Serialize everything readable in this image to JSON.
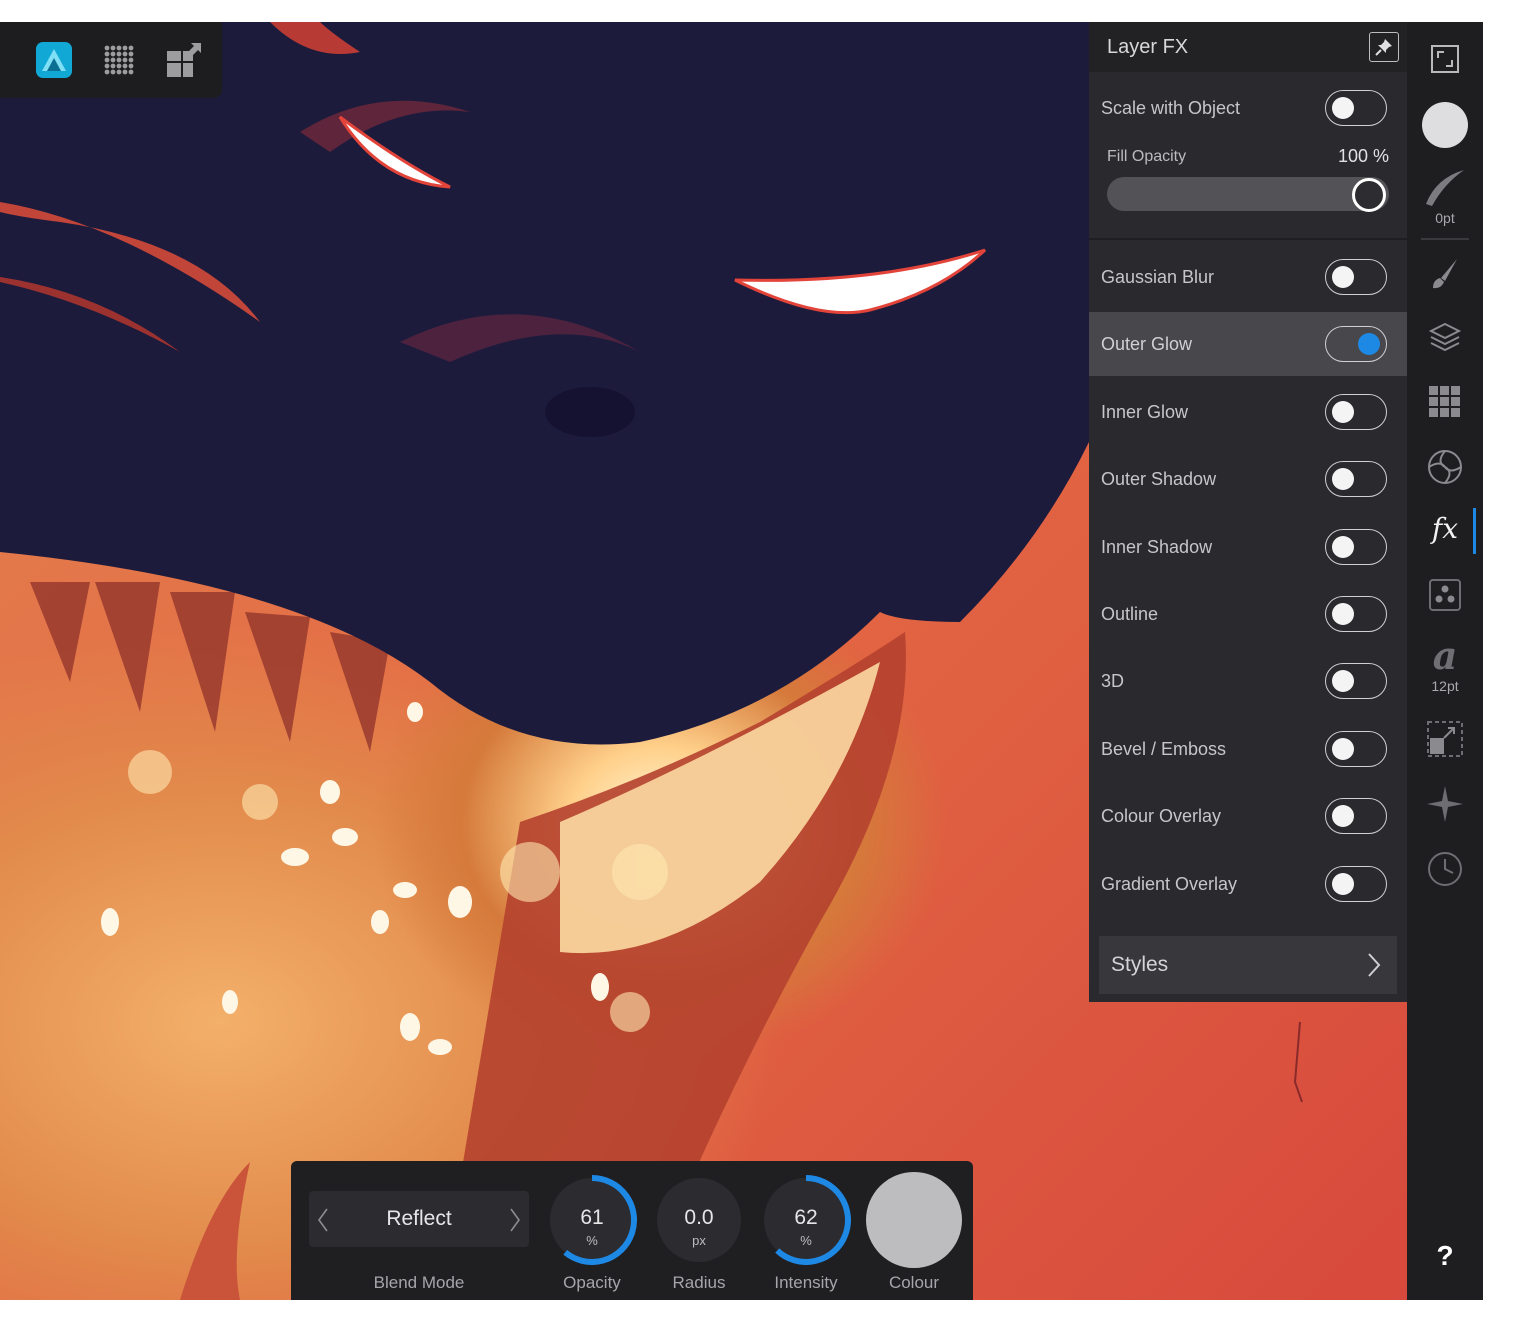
{
  "app_toolbar": {
    "items": [
      {
        "name": "app-logo-icon"
      },
      {
        "name": "grid-dots-icon"
      },
      {
        "name": "export-persona-icon"
      }
    ]
  },
  "layer_fx_panel": {
    "title": "Layer FX",
    "scale_with_object": {
      "label": "Scale with Object",
      "on": false
    },
    "fill_opacity": {
      "label": "Fill Opacity",
      "value_text": "100 %",
      "value": 1.0
    },
    "effects": [
      {
        "label": "Gaussian Blur",
        "on": false
      },
      {
        "label": "Outer Glow",
        "on": true
      },
      {
        "label": "Inner Glow",
        "on": false
      },
      {
        "label": "Outer Shadow",
        "on": false
      },
      {
        "label": "Inner Shadow",
        "on": false
      },
      {
        "label": "Outline",
        "on": false
      },
      {
        "label": "3D",
        "on": false
      },
      {
        "label": "Bevel / Emboss",
        "on": false
      },
      {
        "label": "Colour Overlay",
        "on": false
      },
      {
        "label": "Gradient Overlay",
        "on": false
      }
    ],
    "styles_label": "Styles"
  },
  "right_toolbar": {
    "stroke_caption": "0pt",
    "text_caption": "12pt",
    "fx_label": "fx",
    "text_glyph": "a",
    "help_label": "?"
  },
  "context_bar": {
    "blend_mode": {
      "value": "Reflect",
      "caption": "Blend Mode"
    },
    "opacity": {
      "value": "61",
      "unit": "%",
      "caption": "Opacity",
      "level": 0.61
    },
    "radius": {
      "value": "0.0",
      "unit": "px",
      "caption": "Radius",
      "level": 0.0
    },
    "intensity": {
      "value": "62",
      "unit": "%",
      "caption": "Intensity",
      "level": 0.62
    },
    "colour": {
      "caption": "Colour",
      "swatch": "#bdbcbf"
    }
  },
  "colors": {
    "accent": "#1e88e5",
    "panel_bg": "#2a292d",
    "toolbar_bg": "#1e1d20"
  }
}
